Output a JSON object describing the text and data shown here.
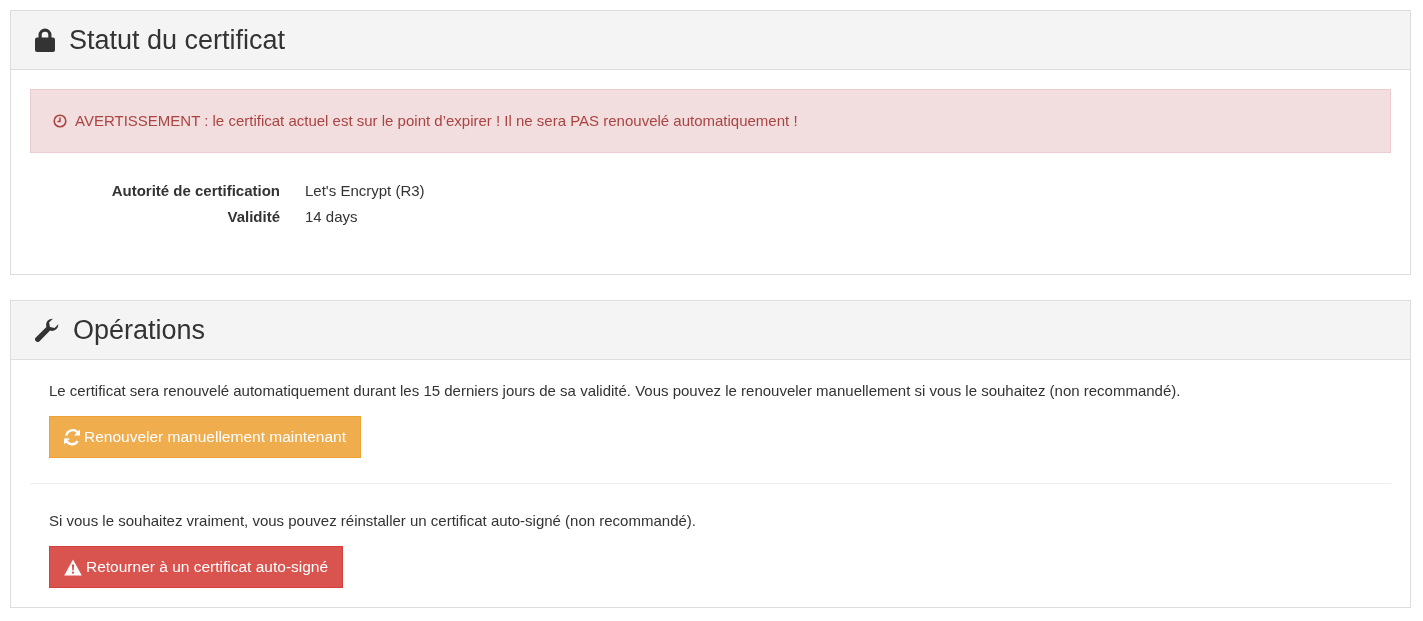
{
  "status_panel": {
    "title": "Statut du certificat",
    "alert": {
      "text": "AVERTISSEMENT : le certificat actuel est sur le point d’expirer ! Il ne sera PAS renouvelé automatiquement !"
    },
    "details": [
      {
        "label": "Autorité de certification",
        "value": "Let's Encrypt (R3)"
      },
      {
        "label": "Validité",
        "value": "14 days"
      }
    ]
  },
  "operations_panel": {
    "title": "Opérations",
    "sections": [
      {
        "text": "Le certificat sera renouvelé automatiquement durant les 15 derniers jours de sa validité. Vous pouvez le renouveler manuellement si vous le souhaitez (non recommandé).",
        "button": {
          "kind": "warning",
          "label": "Renouveler manuellement maintenant"
        }
      },
      {
        "text": "Si vous le souhaitez vraiment, vous pouvez réinstaller un certificat auto-signé (non recommandé).",
        "button": {
          "kind": "danger",
          "label": "Retourner à un certificat auto-signé"
        }
      }
    ]
  }
}
